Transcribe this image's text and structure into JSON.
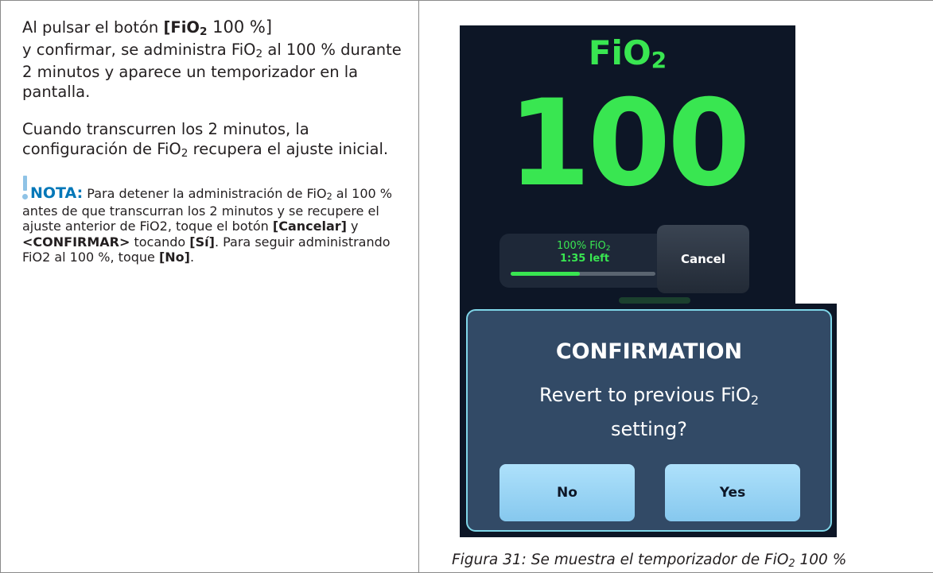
{
  "left_text": {
    "p1_a": "Al pulsar el botón ",
    "p1_button_a": "[FiO",
    "p1_button_sub": "2",
    "p1_button_b": " 100 %]",
    "p1_b": "y confirmar, se administra FiO",
    "p1_b_sub": "2",
    "p1_c": " al 100 % durante 2 minutos y aparece un temporizador en la pantalla.",
    "p2_a": "Cuando transcurren los 2 minutos, la configuración de FiO",
    "p2_sub": "2",
    "p2_b": " recupera el ajuste inicial.",
    "note_label": "NOTA:",
    "note_a": " Para detener la administración de FiO",
    "note_sub": "2",
    "note_b": " al 100 % antes de que transcurran los 2 minutos y se recupere el ajuste anterior de FiO2, toque el botón ",
    "note_cancel": "[Cancelar]",
    "note_c": " y ",
    "note_confirm": "<CONFIRMAR>",
    "note_d": " tocando ",
    "note_yes": "[Sí]",
    "note_e": ". Para seguir administrando FiO2 al 100 %, toque ",
    "note_no": "[No]",
    "note_f": "."
  },
  "device": {
    "title": "FiO",
    "title_sub": "2",
    "value": "100",
    "timer_label": "100% FiO",
    "timer_label_sub": "2",
    "timer_left": "1:35 left",
    "timer_progress": 0.48,
    "cancel_label": "Cancel"
  },
  "dialog": {
    "title": "CONFIRMATION",
    "message_a": "Revert to previous FiO",
    "message_sub": "2",
    "message_b": "setting?",
    "no_label": "No",
    "yes_label": "Yes"
  },
  "caption": {
    "text_a": "Figura 31: Se muestra el temporizador de FiO",
    "text_sub": "2",
    "text_b": " 100 %"
  },
  "colors": {
    "accent_green": "#39e651",
    "note_blue": "#0077b8",
    "screen_bg": "#0d1626",
    "dialog_bg": "#324a66"
  }
}
